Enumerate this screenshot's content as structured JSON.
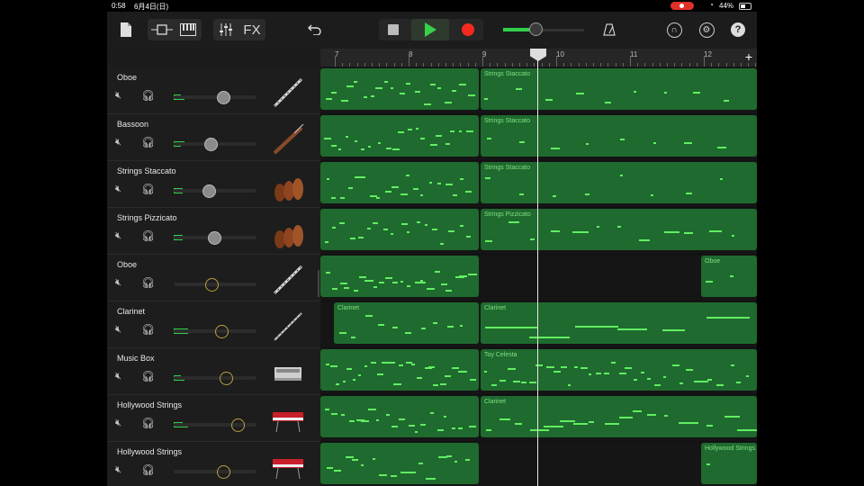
{
  "status": {
    "time": "0:58",
    "date": "6月4日(日)",
    "battery": "44%"
  },
  "toolbar": {
    "fx_label": "FX"
  },
  "ruler": {
    "bars": [
      "7",
      "8",
      "9",
      "10",
      "11",
      "12"
    ],
    "add": "+"
  },
  "tracks": [
    {
      "name": "Oboe",
      "instrument": "oboe-icon"
    },
    {
      "name": "Bassoon",
      "instrument": "bassoon-icon"
    },
    {
      "name": "Strings Staccato",
      "instrument": "strings-icon"
    },
    {
      "name": "Strings Pizzicato",
      "instrument": "strings-icon"
    },
    {
      "name": "Oboe",
      "instrument": "oboe-icon"
    },
    {
      "name": "Clarinet",
      "instrument": "clarinet-icon"
    },
    {
      "name": "Music Box",
      "instrument": "music-box-icon"
    },
    {
      "name": "Hollywood Strings",
      "instrument": "keyboard-icon"
    },
    {
      "name": "Hollywood Strings",
      "instrument": "keyboard-icon"
    }
  ],
  "regions": {
    "r0b": "Strings Staccato",
    "r1b": "Strings Staccato",
    "r2b": "Strings Staccato",
    "r3b": "Strings Pizzicato",
    "r4b": "Oboe",
    "r5a": "Clarinet",
    "r5b": "Clarinet",
    "r6b": "Toy Celesta",
    "r7b": "Clarinet",
    "r8b": "Hollywood Strings"
  },
  "colors": {
    "region": "#1f6a2f",
    "note": "#61ee61",
    "accent": "#2fd14a",
    "record": "#f42a1e"
  }
}
